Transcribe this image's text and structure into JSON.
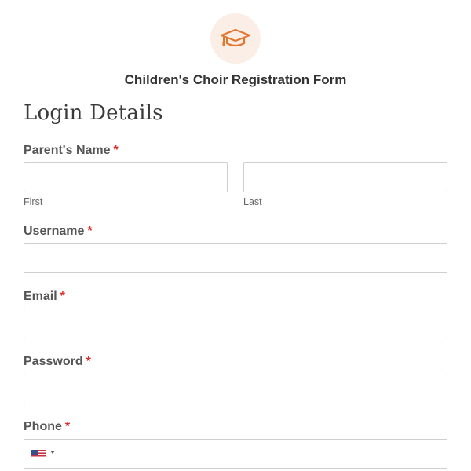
{
  "form": {
    "title": "Children's Choir Registration Form",
    "header_icon": "graduation-cap-icon",
    "accent_color": "#e27730",
    "required_marker": "*",
    "section_heading": "Login Details"
  },
  "fields": {
    "parent_name": {
      "label": "Parent's Name",
      "first_sublabel": "First",
      "last_sublabel": "Last",
      "first_value": "",
      "last_value": ""
    },
    "username": {
      "label": "Username",
      "value": ""
    },
    "email": {
      "label": "Email",
      "value": ""
    },
    "password": {
      "label": "Password",
      "value": ""
    },
    "phone": {
      "label": "Phone",
      "value": "",
      "country_icon": "us-flag-icon"
    }
  }
}
